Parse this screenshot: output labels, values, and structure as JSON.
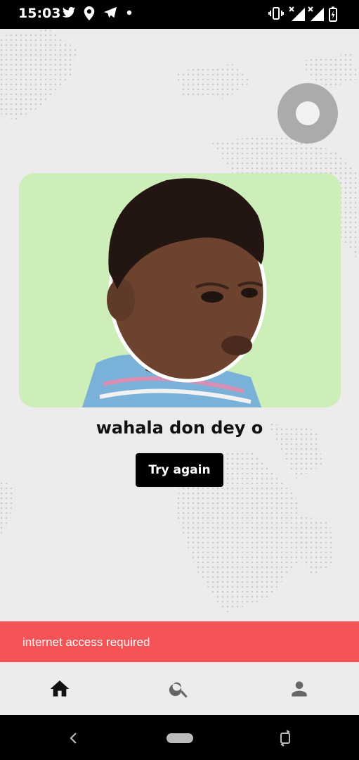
{
  "status_bar": {
    "time": "15:03",
    "left_icons": [
      "twitter-icon",
      "location-icon",
      "telegram-icon",
      "dot-icon"
    ],
    "right_icons": [
      "vibrate-icon",
      "signal-x-icon",
      "signal-x-icon",
      "battery-icon"
    ]
  },
  "loader": {
    "icon": "loading-circle-icon"
  },
  "error": {
    "image_alt": "child-meme-image",
    "title": "wahala don dey o",
    "retry_label": "Try again"
  },
  "snackbar": {
    "message": "internet access required",
    "color": "#f55356"
  },
  "bottom_nav": {
    "items": [
      {
        "name": "home",
        "icon": "home-icon",
        "active": true
      },
      {
        "name": "search",
        "icon": "search-icon",
        "active": false
      },
      {
        "name": "profile",
        "icon": "person-icon",
        "active": false
      }
    ]
  },
  "system_nav": {
    "icons": [
      "back-icon",
      "home-pill-icon",
      "rotate-icon"
    ]
  },
  "colors": {
    "accent": "#000000",
    "background": "#ececec",
    "meme_bg": "#cdeeb9"
  }
}
